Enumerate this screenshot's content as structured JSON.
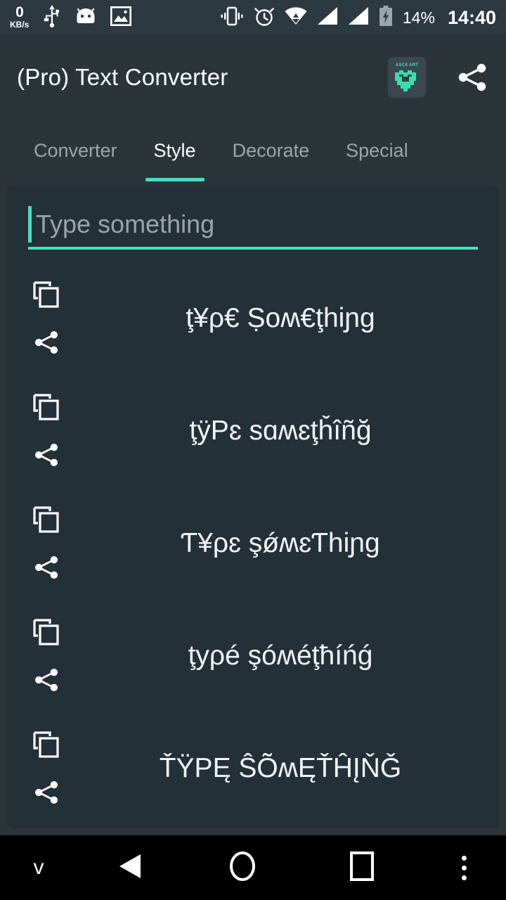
{
  "status_bar": {
    "net_speed_value": "0",
    "net_speed_unit": "KB/s",
    "icons": [
      "usb-icon",
      "android-head-icon",
      "photo-icon",
      "vibrate-icon",
      "alarm-icon",
      "wifi-icon",
      "signal-1-icon",
      "signal-2-icon",
      "battery-charging-icon"
    ],
    "battery_percent": "14%",
    "clock": "14:40"
  },
  "appbar": {
    "title": "(Pro) Text Converter",
    "app_icon_label": "ASCII ART",
    "app_icon_name": "ascii-art-app-icon",
    "share_icon_name": "share-icon"
  },
  "tabs": {
    "items": [
      {
        "label": "Converter",
        "active": false
      },
      {
        "label": "Style",
        "active": true
      },
      {
        "label": "Decorate",
        "active": false
      },
      {
        "label": "Special",
        "active": false
      }
    ],
    "active_index": 1,
    "indicator_color": "#4ddbc0"
  },
  "input": {
    "value": "",
    "placeholder": "Type something",
    "underline_color": "#4ddbc0",
    "caret_color": "#4ddbc0"
  },
  "results": {
    "copy_label": "copy-icon",
    "share_label": "share-icon",
    "rows": [
      {
        "text": "ţ¥ρ€ Ṣoʍ€ţhiɲg"
      },
      {
        "text": "ţÿΡɛ ѕɑʍɛţȟîñğ"
      },
      {
        "text": "Ƭ¥ρɛ şǿʍɛƬhiɲg"
      },
      {
        "text": "ţyρé şóʍéţħíńǵ"
      },
      {
        "text": "ŤŸΡĘ ŜÕʍĘŤĤĮŇǦ"
      }
    ]
  },
  "navbar": {
    "hide_keyboard_label": "v",
    "back_icon": "back-triangle-icon",
    "home_icon": "home-circle-icon",
    "recents_icon": "recents-square-icon",
    "more_icon": "overflow-menu-icon"
  },
  "colors": {
    "background": "#2b3439",
    "card": "#243038",
    "accent": "#4ddbc0",
    "text_primary": "#ffffff",
    "text_muted": "#9ba7ad",
    "navbar": "#000000"
  }
}
